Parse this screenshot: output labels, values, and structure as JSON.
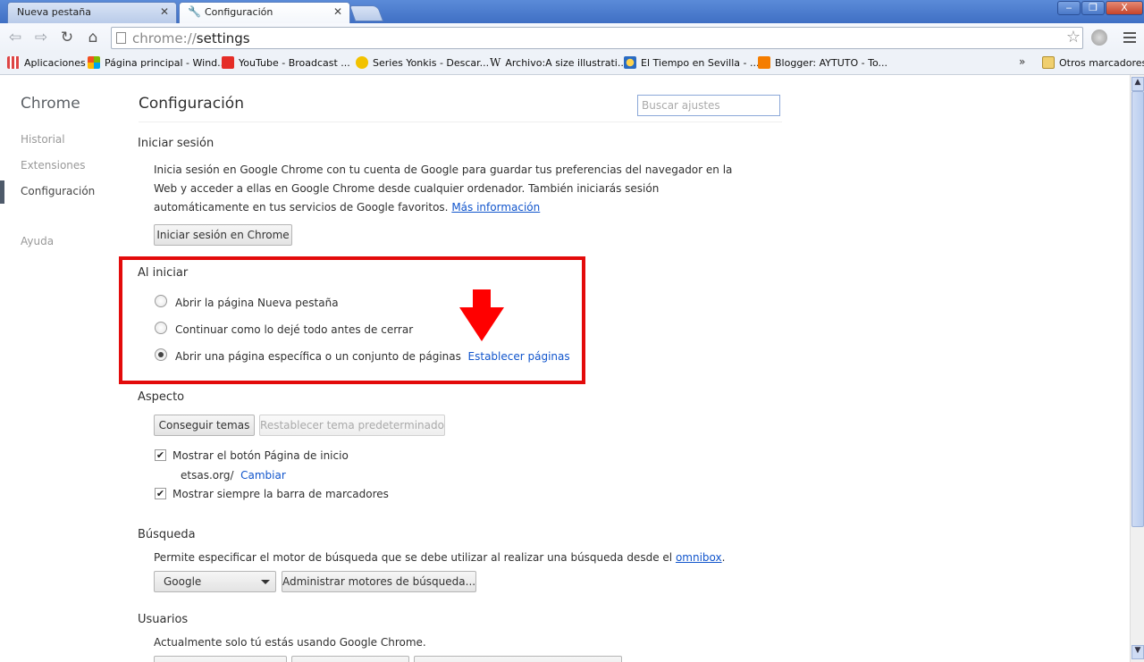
{
  "window": {
    "tabs": [
      {
        "title": "Nueva pestaña"
      },
      {
        "title": "Configuración"
      }
    ],
    "minimize_glyph": "‒",
    "maximize_glyph": "❐",
    "close_glyph": "X"
  },
  "toolbar": {
    "url_scheme": "chrome://",
    "url_path": "settings"
  },
  "bookmarks": {
    "items": [
      {
        "label": "Aplicaciones",
        "icon": "apps-grid-icon",
        "color": "#d44"
      },
      {
        "label": "Página principal - Wind...",
        "icon": "windows-logo-icon",
        "color": "#f25022"
      },
      {
        "label": "YouTube - Broadcast ...",
        "icon": "youtube-icon",
        "color": "#e52d27"
      },
      {
        "label": "Series Yonkis - Descar...",
        "icon": "series-yonkis-icon",
        "color": "#f2c200"
      },
      {
        "label": "Archivo:A size illustrati...",
        "icon": "wikipedia-icon",
        "color": "#222"
      },
      {
        "label": "El Tiempo en Sevilla - ...",
        "icon": "weather-sun-icon",
        "color": "#f5a623"
      },
      {
        "label": "Blogger: AYTUTO - To...",
        "icon": "blogger-icon",
        "color": "#f57d00"
      }
    ],
    "overflow": "»",
    "other": "Otros marcadores"
  },
  "sidebar": {
    "title": "Chrome",
    "items": [
      {
        "label": "Historial"
      },
      {
        "label": "Extensiones"
      },
      {
        "label": "Configuración"
      },
      {
        "label": "Ayuda"
      }
    ]
  },
  "main": {
    "title": "Configuración",
    "search_placeholder": "Buscar ajustes",
    "signin": {
      "title": "Iniciar sesión",
      "line1": "Inicia sesión en Google Chrome con tu cuenta de Google para guardar tus preferencias del navegador en la",
      "line2": "Web y acceder a ellas en Google Chrome desde cualquier ordenador. También iniciarás sesión",
      "line3": "automáticamente en tus servicios de Google favoritos.",
      "more_link": "Más información",
      "button": "Iniciar sesión en Chrome"
    },
    "startup": {
      "title": "Al iniciar",
      "options": [
        {
          "label": "Abrir la página Nueva pestaña",
          "checked": false
        },
        {
          "label": "Continuar como lo dejé todo antes de cerrar",
          "checked": false
        },
        {
          "label": "Abrir una página específica o un conjunto de páginas",
          "checked": true
        }
      ],
      "set_pages_link": "Establecer páginas"
    },
    "appearance": {
      "title": "Aspecto",
      "get_themes": "Conseguir temas",
      "reset_theme": "Restablecer tema predeterminado",
      "show_home": "Mostrar el botón Página de inicio",
      "home_url": "etsas.org/",
      "change_link": "Cambiar",
      "show_bookmarks": "Mostrar siempre la barra de marcadores",
      "check_glyph": "✔"
    },
    "search": {
      "title": "Búsqueda",
      "desc": "Permite especificar el motor de búsqueda que se debe utilizar al realizar una búsqueda desde el",
      "omnibox_link": "omnibox",
      "desc_end": ".",
      "engine": "Google",
      "manage": "Administrar motores de búsqueda..."
    },
    "users": {
      "title": "Usuarios",
      "desc": "Actualmente solo tú estás usando Google Chrome."
    }
  },
  "colors": {
    "highlight": "#e30b0b",
    "link": "#1155cc"
  }
}
